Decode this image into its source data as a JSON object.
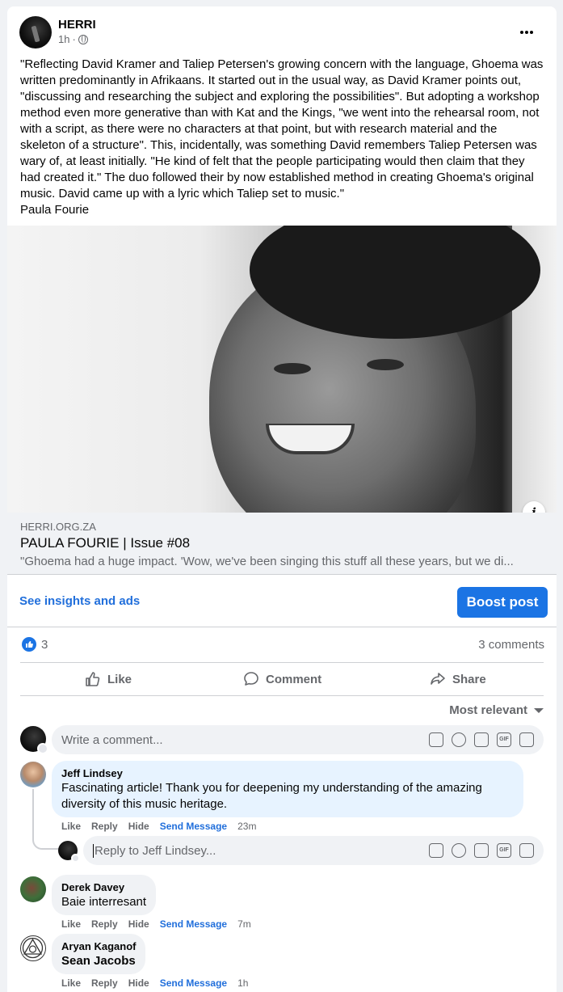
{
  "post": {
    "page_name": "HERRI",
    "time": "1h",
    "separator": "·",
    "text": "\"Reflecting David Kramer and Taliep Petersen's growing concern with the language, Ghoema was written predominantly in Afrikaans. It started out in the usual way, as David Kramer points out, \"discussing and researching the subject and exploring the possibilities\". But adopting a workshop method even more generative than with Kat and the Kings, \"we went into the rehearsal room, not with a script, as there were no characters at that point, but with research material and the skeleton of a structure\". This, incidentally, was something David remembers Taliep Petersen was wary of, at least initially. \"He kind of felt that the people participating would then claim that they had created it.\" The duo followed their by now established method in creating Ghoema's original music. David came up with a lyric which Taliep set to music.\"\nPaula Fourie",
    "more_icon": "more-horizontal-icon"
  },
  "link": {
    "domain": "HERRI.ORG.ZA",
    "title": "PAULA FOURIE | Issue #08",
    "description": "\"Ghoema had a huge impact. 'Wow, we've been singing this stuff all these years, but we di...",
    "info_glyph": "i"
  },
  "promo": {
    "insights_label": "See insights and ads",
    "boost_label": "Boost post"
  },
  "stats": {
    "reactions": "3",
    "comments": "3 comments"
  },
  "actions": {
    "like": "Like",
    "comment": "Comment",
    "share": "Share"
  },
  "sort": {
    "label": "Most relevant"
  },
  "composer": {
    "placeholder": "Write a comment...",
    "reply_placeholder": "Reply to Jeff Lindsey...",
    "gif_label": "GIF"
  },
  "comments": [
    {
      "author": "Jeff Lindsey",
      "text": "Fascinating article! Thank you for deepening my understanding of the amazing diversity of this music heritage.",
      "like": "Like",
      "reply": "Reply",
      "hide": "Hide",
      "send": "Send Message",
      "time": "23m"
    },
    {
      "author": "Derek Davey",
      "text": "Baie interresant",
      "like": "Like",
      "reply": "Reply",
      "hide": "Hide",
      "send": "Send Message",
      "time": "7m"
    },
    {
      "author": "Aryan Kaganof",
      "text": "Sean Jacobs",
      "like": "Like",
      "reply": "Reply",
      "hide": "Hide",
      "send": "Send Message",
      "time": "1h"
    }
  ],
  "colors": {
    "accent": "#1b74e4",
    "link": "#216fdb",
    "muted": "#65676b",
    "highlight_bubble": "#e7f3ff"
  }
}
